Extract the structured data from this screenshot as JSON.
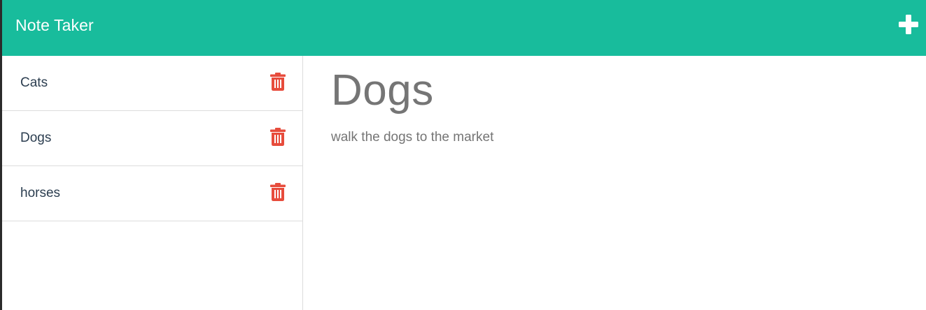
{
  "navbar": {
    "brand": "Note Taker",
    "new_note_icon": "plus-icon"
  },
  "sidebar": {
    "notes": [
      {
        "title": "Cats",
        "delete_icon": "trash-icon"
      },
      {
        "title": "Dogs",
        "delete_icon": "trash-icon"
      },
      {
        "title": "horses",
        "delete_icon": "trash-icon"
      }
    ]
  },
  "active_note": {
    "title": "Dogs",
    "text": "walk the dogs to the market"
  },
  "colors": {
    "primary": "#18bc9c",
    "delete": "#e74c3c",
    "text_dark": "#2c3e50",
    "text_muted": "#757575"
  }
}
